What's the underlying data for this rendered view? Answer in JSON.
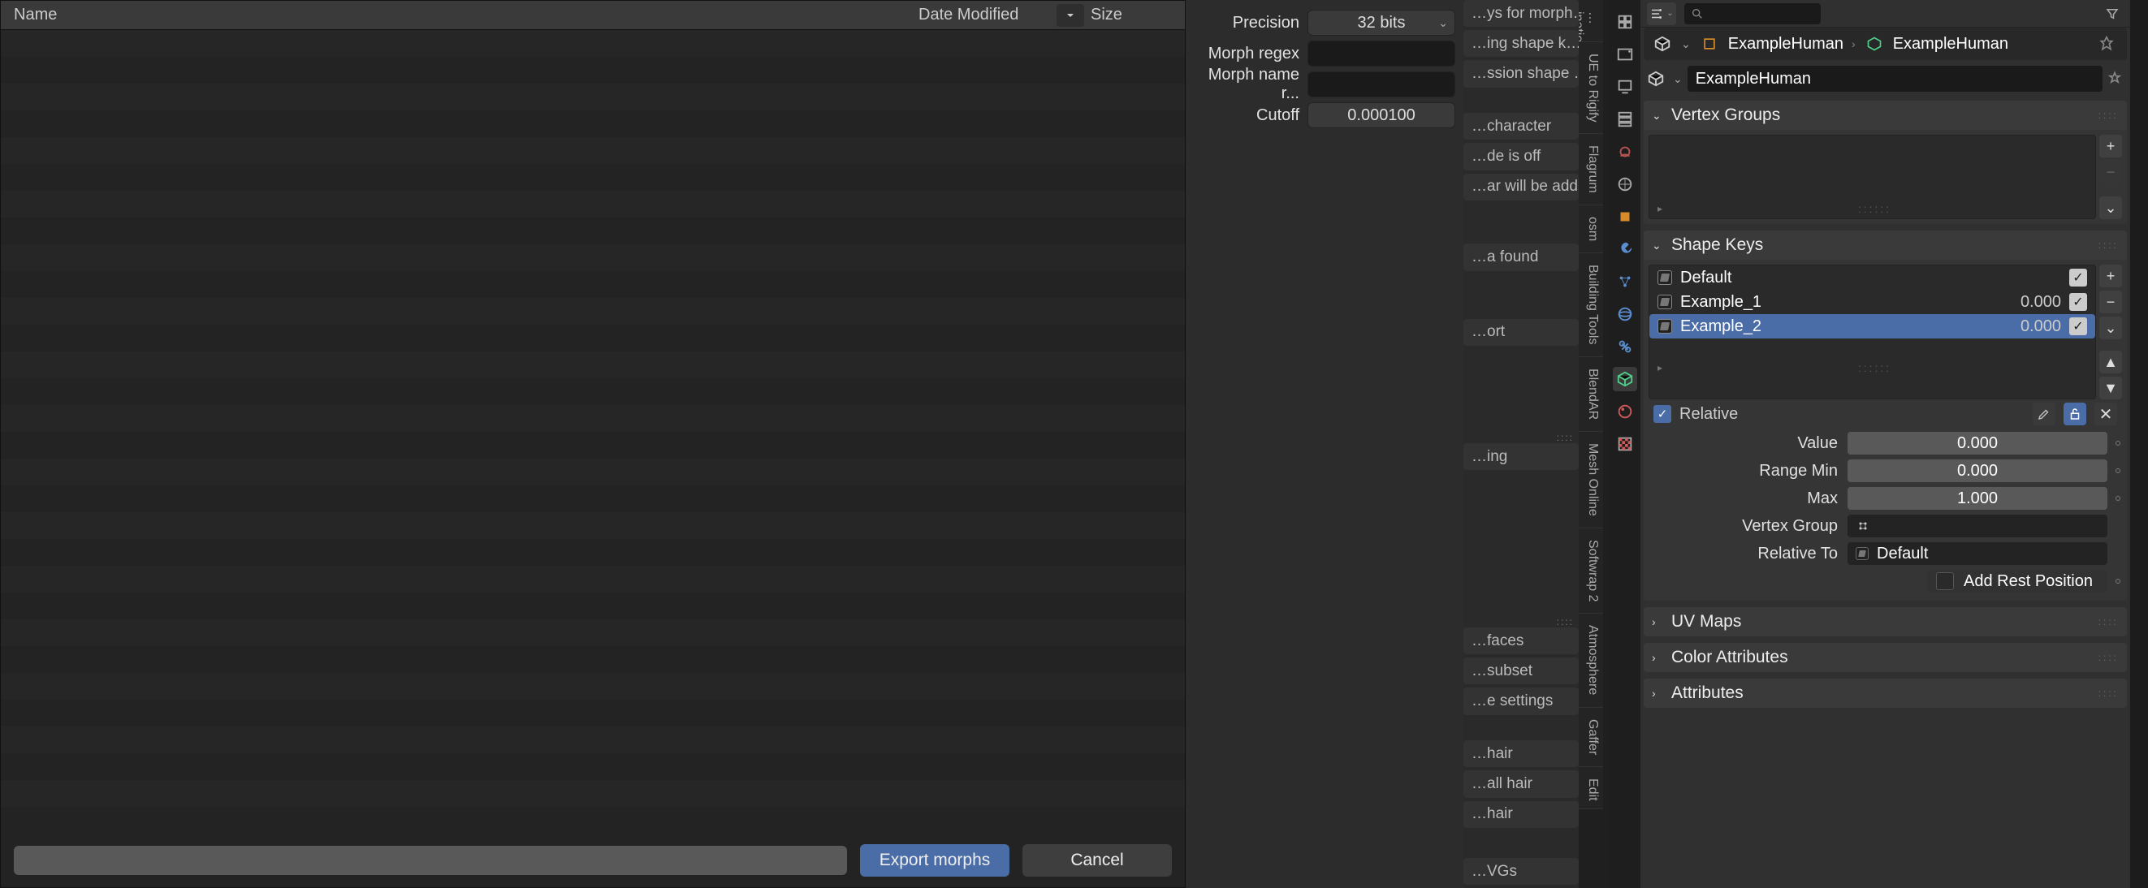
{
  "filebrowser": {
    "columns": {
      "name": "Name",
      "date": "Date Modified",
      "size": "Size"
    },
    "actions": {
      "export": "Export morphs",
      "cancel": "Cancel"
    }
  },
  "options": {
    "precision": {
      "label": "Precision",
      "value": "32 bits"
    },
    "morph_regex": {
      "label": "Morph regex",
      "value": ""
    },
    "morph_name": {
      "label": "Morph name r...",
      "value": ""
    },
    "cutoff": {
      "label": "Cutoff",
      "value": "0.000100"
    }
  },
  "sliver": {
    "lines": [
      "…ys for morph…",
      "…ing shape k…",
      "…ssion shape …",
      "…character",
      "…de is off",
      "…ar will be add…",
      "…a found",
      "…ort",
      "…ing",
      "…faces",
      "…subset",
      "…e settings",
      "…hair",
      "…all hair",
      "…hair",
      "…VGs"
    ]
  },
  "vtabs": [
    "…ination",
    "UE to Rigify",
    "Flagrum",
    "osm",
    "Building Tools",
    "BlendAR",
    "Mesh Online",
    "Softwrap 2",
    "Atmosphere",
    "Gaffer",
    "Edit"
  ],
  "breadcrumb": {
    "obj": "ExampleHuman",
    "data": "ExampleHuman",
    "name_field": "ExampleHuman"
  },
  "panels": {
    "vertex_groups": {
      "title": "Vertex Groups"
    },
    "shape_keys": {
      "title": "Shape Keys",
      "items": [
        {
          "name": "Default",
          "value": ""
        },
        {
          "name": "Example_1",
          "value": "0.000"
        },
        {
          "name": "Example_2",
          "value": "0.000"
        }
      ],
      "relative_label": "Relative",
      "value": {
        "label": "Value",
        "val": "0.000"
      },
      "range_min": {
        "label": "Range Min",
        "val": "0.000"
      },
      "range_max": {
        "label": "Max",
        "val": "1.000"
      },
      "vgroup": {
        "label": "Vertex Group",
        "val": ""
      },
      "rel_to": {
        "label": "Relative To",
        "val": "Default"
      },
      "add_rest": "Add Rest Position"
    },
    "uv": {
      "title": "UV Maps"
    },
    "color_attr": {
      "title": "Color Attributes"
    },
    "attributes": {
      "title": "Attributes"
    }
  }
}
